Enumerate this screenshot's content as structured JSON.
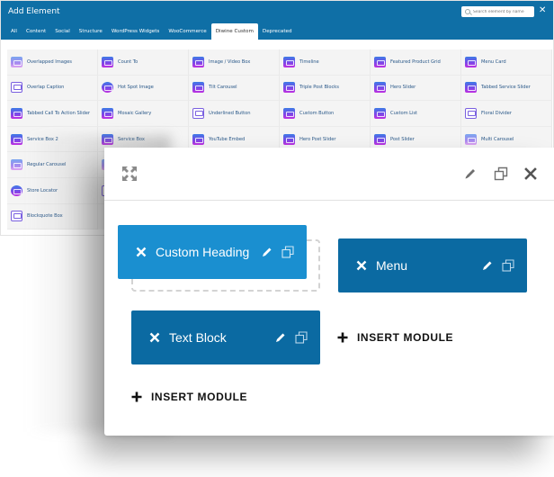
{
  "add_element": {
    "title": "Add Element",
    "search_placeholder": "Search element by name",
    "close_icon": "close-icon",
    "tabs": [
      {
        "label": "All",
        "active": false
      },
      {
        "label": "Content",
        "active": false
      },
      {
        "label": "Social",
        "active": false
      },
      {
        "label": "Structure",
        "active": false
      },
      {
        "label": "WordPress Widgets",
        "active": false
      },
      {
        "label": "WooCommerce",
        "active": false
      },
      {
        "label": "Diwine Custom",
        "active": true
      },
      {
        "label": "Deprecated",
        "active": false
      }
    ],
    "elements": [
      {
        "label": "Overlapped Images",
        "icon": "layers-icon"
      },
      {
        "label": "Count To",
        "icon": "counter-icon"
      },
      {
        "label": "Image / Video Box",
        "icon": "image-video-icon"
      },
      {
        "label": "Timeline",
        "icon": "timeline-icon"
      },
      {
        "label": "Featured Product Grid",
        "icon": "grid-icon"
      },
      {
        "label": "Menu Card",
        "icon": "menu-card-icon"
      },
      {
        "label": "Overlap Caption",
        "icon": "text-caption-icon"
      },
      {
        "label": "Hot Spot Image",
        "icon": "hotspot-icon"
      },
      {
        "label": "Tilt Carousel",
        "icon": "tilt-carousel-icon"
      },
      {
        "label": "Triple Post Blocks",
        "icon": "post-blocks-icon"
      },
      {
        "label": "Hero Slider",
        "icon": "hero-slider-icon"
      },
      {
        "label": "Tabbed Service Slider",
        "icon": "tabbed-slider-icon"
      },
      {
        "label": "Tabbed Call To Action Slider",
        "icon": "cta-slider-icon"
      },
      {
        "label": "Mosaic Gallery",
        "icon": "mosaic-icon"
      },
      {
        "label": "Underlined Button",
        "icon": "link-button-icon"
      },
      {
        "label": "Custom Button",
        "icon": "pointer-icon"
      },
      {
        "label": "Custom List",
        "icon": "list-icon"
      },
      {
        "label": "Floral Divider",
        "icon": "divider-icon"
      },
      {
        "label": "Service Box 2",
        "icon": "gears-icon"
      },
      {
        "label": "Service Box",
        "icon": "code-icon"
      },
      {
        "label": "YouTube Embed",
        "icon": "video-play-icon"
      },
      {
        "label": "Hero Post Slider",
        "icon": "post-slider-icon"
      },
      {
        "label": "Post Slider",
        "icon": "slider-icon"
      },
      {
        "label": "Multi Carousel",
        "icon": "carousel-icon"
      },
      {
        "label": "Regular Carousel",
        "icon": "carousel-icon"
      },
      {
        "label": "",
        "icon": "carousel-icon"
      },
      {
        "label": "",
        "icon": "",
        "hidden": true
      },
      {
        "label": "",
        "icon": "",
        "hidden": true
      },
      {
        "label": "",
        "icon": "",
        "hidden": true
      },
      {
        "label": "",
        "icon": "",
        "hidden": true
      },
      {
        "label": "Store Locator",
        "icon": "map-pin-icon"
      },
      {
        "label": "",
        "icon": "box-icon"
      },
      {
        "label": "",
        "icon": "",
        "hidden": true
      },
      {
        "label": "",
        "icon": "",
        "hidden": true
      },
      {
        "label": "",
        "icon": "",
        "hidden": true
      },
      {
        "label": "",
        "icon": "",
        "hidden": true
      },
      {
        "label": "Blockquote Box",
        "icon": "quote-icon"
      }
    ]
  },
  "builder": {
    "toolbar": {
      "expand_icon": "expand-icon",
      "edit_icon": "pencil-icon",
      "clone_icon": "clone-icon",
      "close_icon": "close-icon"
    },
    "modules": [
      {
        "label": "Custom Heading",
        "state": "dragging",
        "color": "#1a8fd0"
      },
      {
        "label": "Menu",
        "state": "normal",
        "color": "#0b6aa2"
      },
      {
        "label": "Text Block",
        "state": "normal",
        "color": "#0b6aa2"
      }
    ],
    "insert_module_label": "INSERT MODULE",
    "insert_module_label_2": "INSERT MODULE"
  },
  "colors": {
    "header_blue": "#0f6fa6",
    "module_blue": "#0b6aa2",
    "module_active_blue": "#1a8fd0"
  }
}
